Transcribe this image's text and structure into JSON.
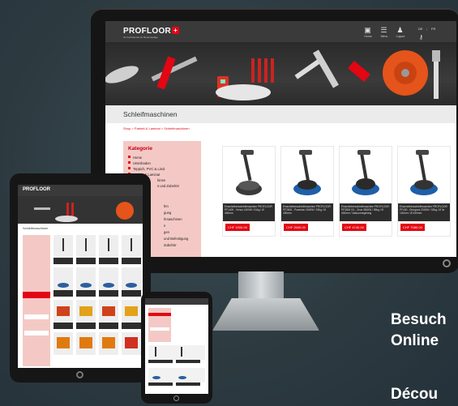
{
  "desktop": {
    "logo_text": "PROFLOOR",
    "logo_plus": "+",
    "logo_tagline": "Ihr Fachhandel für Bodenbeläge",
    "nav": [
      {
        "icon": "home-icon",
        "label": "Home"
      },
      {
        "icon": "menu-icon",
        "label": "Menu"
      },
      {
        "icon": "user-icon",
        "label": "Logout"
      }
    ],
    "lang": [
      "DE",
      "FR"
    ],
    "page_title": "Schleifmaschinen",
    "breadcrumb": "Shop > Parkett & Laminat > Schleifmaschinen",
    "sidebar": {
      "heading": "Kategorie",
      "items": [
        "Home",
        "Unterboden",
        "Teppich, PVC & Linol",
        "Parkett & Laminat"
      ],
      "partial_items": [
        "hinen",
        "s und Zubehör"
      ]
    },
    "products": [
      {
        "desc": "Einscheibenschleifmaschine PROFLOOR PF1400 - Venus 1400W / 61kg / Ø 400mm",
        "price": "CHF 1900.00"
      },
      {
        "desc": "Einscheibenschleifmaschine PROFLOOR PF2600 - Poseidon 2600W / 52kg / Ø 430mm",
        "price": "CHF 2600.00"
      },
      {
        "desc": "Einscheibenschleifmaschine PROFLOOR PF3500 VX - Zeus 3500W / 55kg / Ø 400mm / Vakuumregelung",
        "price": "CHF 4740.00"
      },
      {
        "desc": "Einscheibenschleifmaschine PROFLOOR PF430 - Dionysos 2000W / 52kg / Ø 3x 140mm / Ø 430mm",
        "price": "CHF 7080.00"
      }
    ],
    "sidebar_fragments": [
      "fen",
      "gung",
      "hmaschinen",
      "n",
      "gen",
      "und Befestigung",
      "Zubehör"
    ]
  },
  "tablet": {
    "logo_text": "PROFLOOR",
    "page_title": "Schleifmaschinen"
  },
  "promo": {
    "line1": "Besuch",
    "line2": "Online",
    "line3": "Décou"
  },
  "colors": {
    "brand_red": "#e30613",
    "background": "#2f3e44",
    "sidebar_pink": "#f4c9c5"
  }
}
